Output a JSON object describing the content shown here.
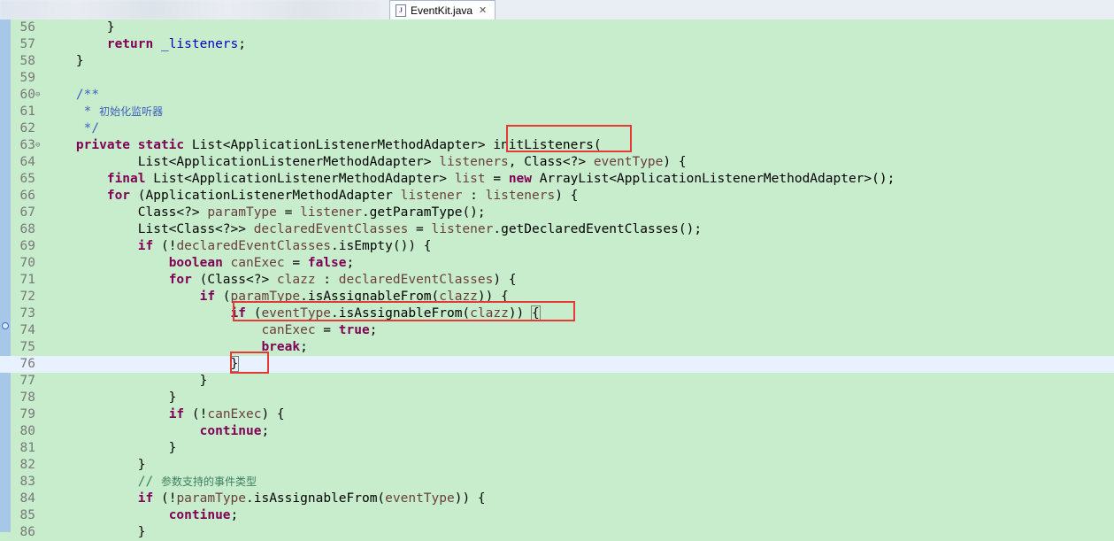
{
  "tabs": {
    "active_label": "EventKit.java",
    "close_glyph": "✕",
    "icon_letter": "J"
  },
  "editor": {
    "lines": [
      {
        "n": "56",
        "segs": [
          [
            "        }",
            ""
          ]
        ]
      },
      {
        "n": "57",
        "segs": [
          [
            "        ",
            ""
          ],
          [
            "return",
            "kw"
          ],
          [
            " ",
            ""
          ],
          [
            "_listeners",
            "fld"
          ],
          [
            ";",
            ""
          ]
        ]
      },
      {
        "n": "58",
        "segs": [
          [
            "    }",
            ""
          ]
        ]
      },
      {
        "n": "59",
        "segs": [
          [
            "",
            ""
          ]
        ]
      },
      {
        "n": "60",
        "fold": "⊖",
        "segs": [
          [
            "    ",
            ""
          ],
          [
            "/**",
            "jd"
          ]
        ]
      },
      {
        "n": "61",
        "segs": [
          [
            "     * ",
            "jd"
          ],
          [
            "初始化监听器",
            "jd cjk"
          ]
        ]
      },
      {
        "n": "62",
        "segs": [
          [
            "     */",
            "jd"
          ]
        ]
      },
      {
        "n": "63",
        "fold": "⊖",
        "segs": [
          [
            "    ",
            ""
          ],
          [
            "private",
            "kw"
          ],
          [
            " ",
            ""
          ],
          [
            "static",
            "kw"
          ],
          [
            " List<ApplicationListenerMethodAdapter> initListeners(",
            ""
          ]
        ]
      },
      {
        "n": "64",
        "segs": [
          [
            "            List<ApplicationListenerMethodAdapter> ",
            ""
          ],
          [
            "listeners",
            "var"
          ],
          [
            ", Class<?> ",
            ""
          ],
          [
            "eventType",
            "var"
          ],
          [
            ") {",
            ""
          ]
        ]
      },
      {
        "n": "65",
        "segs": [
          [
            "        ",
            ""
          ],
          [
            "final",
            "kw"
          ],
          [
            " List<ApplicationListenerMethodAdapter> ",
            ""
          ],
          [
            "list",
            "var"
          ],
          [
            " = ",
            ""
          ],
          [
            "new",
            "kw"
          ],
          [
            " ArrayList<ApplicationListenerMethodAdapter>();",
            ""
          ]
        ]
      },
      {
        "n": "66",
        "segs": [
          [
            "        ",
            ""
          ],
          [
            "for",
            "kw"
          ],
          [
            " (ApplicationListenerMethodAdapter ",
            ""
          ],
          [
            "listener",
            "var"
          ],
          [
            " : ",
            ""
          ],
          [
            "listeners",
            "var"
          ],
          [
            ") {",
            ""
          ]
        ]
      },
      {
        "n": "67",
        "segs": [
          [
            "            Class<?> ",
            ""
          ],
          [
            "paramType",
            "var"
          ],
          [
            " = ",
            ""
          ],
          [
            "listener",
            "var"
          ],
          [
            ".getParamType();",
            ""
          ]
        ]
      },
      {
        "n": "68",
        "segs": [
          [
            "            List<Class<?>> ",
            ""
          ],
          [
            "declaredEventClasses",
            "var"
          ],
          [
            " = ",
            ""
          ],
          [
            "listener",
            "var"
          ],
          [
            ".getDeclaredEventClasses();",
            ""
          ]
        ]
      },
      {
        "n": "69",
        "segs": [
          [
            "            ",
            ""
          ],
          [
            "if",
            "kw"
          ],
          [
            " (!",
            ""
          ],
          [
            "declaredEventClasses",
            "var"
          ],
          [
            ".isEmpty()) {",
            ""
          ]
        ]
      },
      {
        "n": "70",
        "segs": [
          [
            "                ",
            ""
          ],
          [
            "boolean",
            "kw"
          ],
          [
            " ",
            ""
          ],
          [
            "canExec",
            "var"
          ],
          [
            " = ",
            ""
          ],
          [
            "false",
            "kw"
          ],
          [
            ";",
            ""
          ]
        ]
      },
      {
        "n": "71",
        "segs": [
          [
            "                ",
            ""
          ],
          [
            "for",
            "kw"
          ],
          [
            " (Class<?> ",
            ""
          ],
          [
            "clazz",
            "var"
          ],
          [
            " : ",
            ""
          ],
          [
            "declaredEventClasses",
            "var"
          ],
          [
            ") {",
            ""
          ]
        ]
      },
      {
        "n": "72",
        "segs": [
          [
            "                    ",
            ""
          ],
          [
            "if",
            "kw"
          ],
          [
            " (",
            ""
          ],
          [
            "paramType",
            "var"
          ],
          [
            ".isAssignableFrom(",
            ""
          ],
          [
            "clazz",
            "var"
          ],
          [
            ")) {",
            ""
          ]
        ]
      },
      {
        "n": "73",
        "segs": [
          [
            "                        ",
            ""
          ],
          [
            "if",
            "kw"
          ],
          [
            " (",
            ""
          ],
          [
            "eventType",
            "var"
          ],
          [
            ".isAssignableFrom(",
            ""
          ],
          [
            "clazz",
            "var"
          ],
          [
            ")) ",
            ""
          ],
          [
            "{",
            "mark-bracket"
          ]
        ]
      },
      {
        "n": "74",
        "segs": [
          [
            "                            ",
            ""
          ],
          [
            "canExec",
            "var"
          ],
          [
            " = ",
            ""
          ],
          [
            "true",
            "kw"
          ],
          [
            ";",
            ""
          ]
        ]
      },
      {
        "n": "75",
        "segs": [
          [
            "                            ",
            ""
          ],
          [
            "break",
            "kw"
          ],
          [
            ";",
            ""
          ]
        ]
      },
      {
        "n": "76",
        "current": true,
        "segs": [
          [
            "                        ",
            ""
          ],
          [
            "}",
            "mark-bracket"
          ],
          [
            "|",
            "cursor"
          ]
        ]
      },
      {
        "n": "77",
        "segs": [
          [
            "                    }",
            ""
          ]
        ]
      },
      {
        "n": "78",
        "segs": [
          [
            "                }",
            ""
          ]
        ]
      },
      {
        "n": "79",
        "segs": [
          [
            "                ",
            ""
          ],
          [
            "if",
            "kw"
          ],
          [
            " (!",
            ""
          ],
          [
            "canExec",
            "var"
          ],
          [
            ") {",
            ""
          ]
        ]
      },
      {
        "n": "80",
        "segs": [
          [
            "                    ",
            ""
          ],
          [
            "continue",
            "kw"
          ],
          [
            ";",
            ""
          ]
        ]
      },
      {
        "n": "81",
        "segs": [
          [
            "                }",
            ""
          ]
        ]
      },
      {
        "n": "82",
        "segs": [
          [
            "            }",
            ""
          ]
        ]
      },
      {
        "n": "83",
        "segs": [
          [
            "            ",
            ""
          ],
          [
            "// ",
            "cmt"
          ],
          [
            "参数支持的事件类型",
            "cmt cjk"
          ]
        ]
      },
      {
        "n": "84",
        "segs": [
          [
            "            ",
            ""
          ],
          [
            "if",
            "kw"
          ],
          [
            " (!",
            ""
          ],
          [
            "paramType",
            "var"
          ],
          [
            ".isAssignableFrom(",
            ""
          ],
          [
            "eventType",
            "var"
          ],
          [
            ")) {",
            ""
          ]
        ]
      },
      {
        "n": "85",
        "segs": [
          [
            "                ",
            ""
          ],
          [
            "continue",
            "kw"
          ],
          [
            ";",
            ""
          ]
        ]
      },
      {
        "n": "86",
        "segs": [
          [
            "            }",
            ""
          ]
        ]
      }
    ]
  },
  "colors": {
    "background": "#c7edcc",
    "annotation": "#e53935",
    "keyword": "#7f0055",
    "current_line": "#e8f2fe"
  }
}
